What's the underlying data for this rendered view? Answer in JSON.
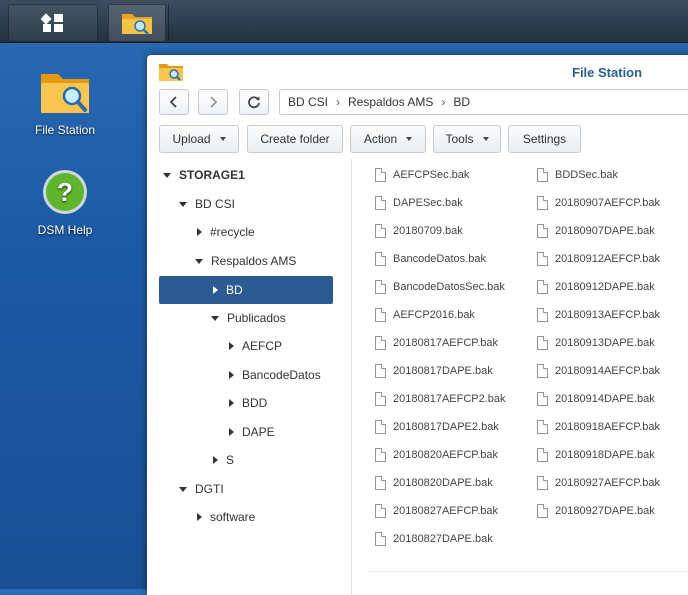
{
  "taskbar": {
    "main_menu_icon": "grid-icon",
    "open_app_icon": "file-station-icon"
  },
  "desktop": {
    "icons": [
      {
        "label": "File Station",
        "icon": "folder-search-icon"
      },
      {
        "label": "DSM Help",
        "icon": "help-icon"
      }
    ]
  },
  "window": {
    "title": "File Station",
    "nav": {
      "back_icon": "chevron-left-icon",
      "forward_icon": "chevron-right-icon",
      "refresh_icon": "refresh-icon"
    },
    "breadcrumb": [
      "BD CSI",
      "Respaldos AMS",
      "BD"
    ],
    "toolbar": {
      "upload": "Upload",
      "create_folder": "Create folder",
      "action": "Action",
      "tools": "Tools",
      "settings": "Settings"
    },
    "tree": [
      {
        "label": "STORAGE1",
        "expanded": true,
        "depth": 0
      },
      {
        "label": "BD CSI",
        "expanded": true,
        "depth": 1
      },
      {
        "label": "#recycle",
        "expanded": false,
        "depth": 2
      },
      {
        "label": "Respaldos AMS",
        "expanded": true,
        "depth": 2
      },
      {
        "label": "BD",
        "expanded": false,
        "depth": 3,
        "selected": true
      },
      {
        "label": "Publicados",
        "expanded": true,
        "depth": 3
      },
      {
        "label": "AEFCP",
        "expanded": false,
        "depth": 4
      },
      {
        "label": "BancodeDatos",
        "expanded": false,
        "depth": 4
      },
      {
        "label": "BDD",
        "expanded": false,
        "depth": 4
      },
      {
        "label": "DAPE",
        "expanded": false,
        "depth": 4
      },
      {
        "label": "S",
        "expanded": false,
        "depth": 3
      },
      {
        "label": "DGTI",
        "expanded": true,
        "depth": 1
      },
      {
        "label": "software",
        "expanded": false,
        "depth": 2
      }
    ],
    "files_col1": [
      "AEFCPSec.bak",
      "DAPESec.bak",
      "20180709.bak",
      "BancodeDatos.bak",
      "BancodeDatosSec.bak",
      "AEFCP2016.bak",
      "20180817AEFCP.bak",
      "20180817DAPE.bak",
      "20180817AEFCP2.bak",
      "20180817DAPE2.bak",
      "20180820AEFCP.bak",
      "20180820DAPE.bak",
      "20180827AEFCP.bak",
      "20180827DAPE.bak"
    ],
    "files_col2": [
      "BDDSec.bak",
      "20180907AEFCP.bak",
      "20180907DAPE.bak",
      "20180912AEFCP.bak",
      "20180912DAPE.bak",
      "20180913AEFCP.bak",
      "20180913DAPE.bak",
      "20180914AEFCP.bak",
      "20180914DAPE.bak",
      "20180918AEFCP.bak",
      "20180918DAPE.bak",
      "20180927AEFCP.bak",
      "20180927DAPE.bak"
    ],
    "file_icon": "file-icon"
  },
  "colors": {
    "desktop": "#1d5ba6",
    "selection": "#2c5a92",
    "title": "#2b5e95"
  }
}
